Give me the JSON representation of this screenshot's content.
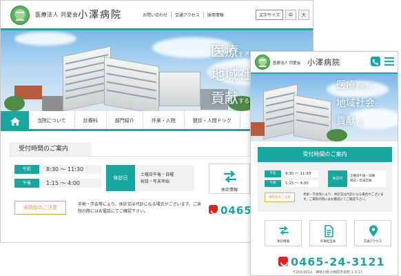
{
  "header": {
    "org": "医療法人 同愛会",
    "name": "小澤病院",
    "top_links": [
      "お問い合わせ",
      "交通アクセス",
      "採用情報"
    ],
    "font_size_label": "文字サイズ",
    "font_size_options": [
      "中",
      "大"
    ]
  },
  "hero": {
    "line1": "医療",
    "line1_suffix": "を通じて",
    "line2": "地域社会",
    "line2_suffix": "に",
    "line3": "貢献",
    "line3_suffix": "する"
  },
  "global_nav": [
    "当院について",
    "診療科",
    "部門紹介",
    "外来・入院",
    "健診・人間ドック"
  ],
  "reception": {
    "title": "受付時間のご案内",
    "morning_label": "午前",
    "morning_time": "8:30 〜 11:30",
    "afternoon_label": "午後",
    "afternoon_time": "1:15 〜 4:00",
    "closed_label": "休診日",
    "closed_line1": "土曜日午後・日曜",
    "closed_line2": "祝日・年末年始",
    "notice_label": "来院前のご注意",
    "notice_text": "手術・学会等により、休診又は代診になる場合がございます。ご来院の際にはお電話にてご確認下さい。"
  },
  "quick_links": {
    "closed_info": "休診情報",
    "outpatient": "外来担当表",
    "access": "交通アクセス"
  },
  "contact": {
    "phone_desktop": "0465",
    "phone": "0465-24-3121",
    "address": "〒250-0012　神奈川県小田原市本町 1-1-17"
  },
  "colors": {
    "accent": "#16a8a0",
    "notice": "#e9913a",
    "tel": "#e02020"
  }
}
